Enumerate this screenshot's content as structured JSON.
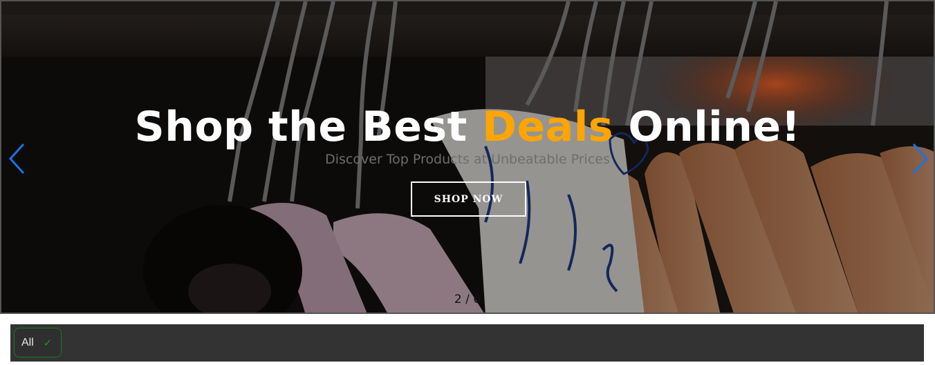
{
  "hero": {
    "headline_part1": "Shop the Best ",
    "headline_accent": "Deals",
    "headline_part2": " Online!",
    "subheadline": "Discover Top Products at Unbeatable Prices",
    "cta_label": "SHOP NOW",
    "pager": "2 / 6",
    "accent_color": "#ffa500",
    "arrow_color": "#1a73e8",
    "background_image": "clothes-hangers-on-rack-photo"
  },
  "filter_bar": {
    "chips": [
      {
        "label": "All",
        "selected": true,
        "check_icon": "checkmark-icon"
      }
    ]
  }
}
